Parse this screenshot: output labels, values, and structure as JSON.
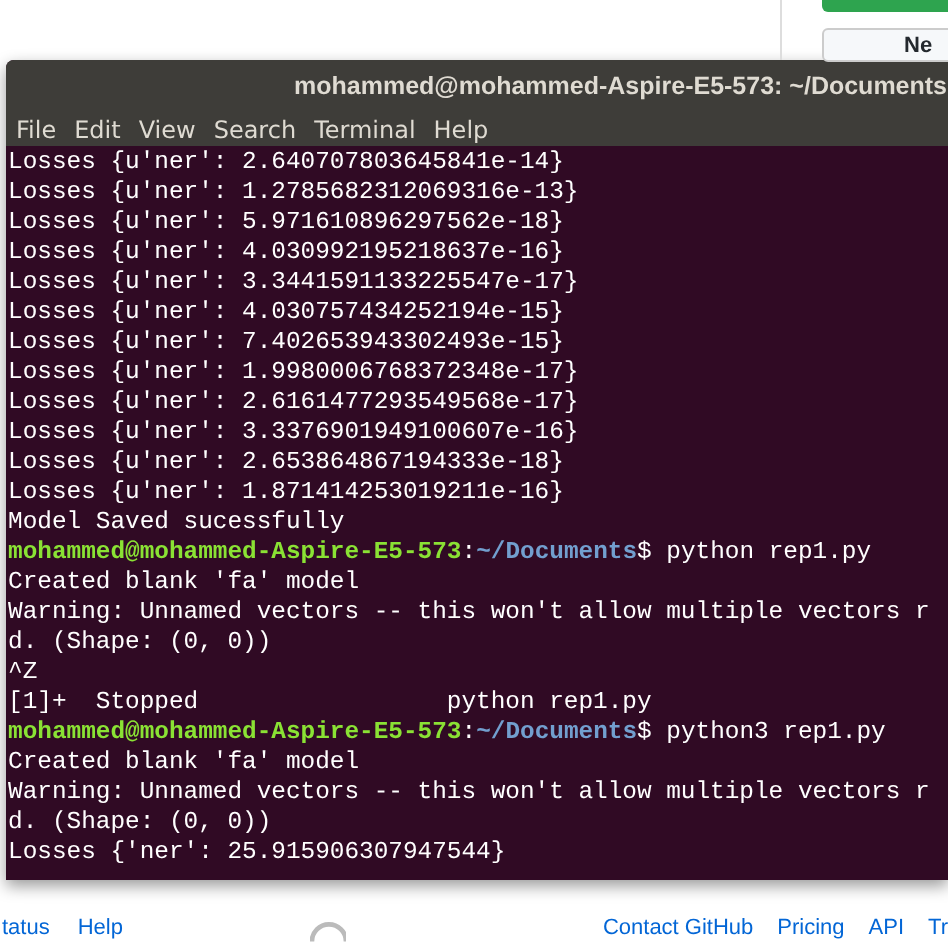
{
  "background_page": {
    "top_buttons": [
      {
        "kind": "primary"
      },
      {
        "kind": "secondary",
        "label": "Ne"
      }
    ],
    "footer_links_left": [
      "tatus",
      "Help"
    ],
    "footer_links_right": [
      "Contact GitHub",
      "Pricing",
      "API",
      "Tr"
    ]
  },
  "window": {
    "title": "mohammed@mohammed-Aspire-E5-573: ~/Documents"
  },
  "menu": [
    "File",
    "Edit",
    "View",
    "Search",
    "Terminal",
    "Help"
  ],
  "lines": [
    {
      "kind": "output",
      "text": "Losses {u'ner': 2.640707803645841e-14}"
    },
    {
      "kind": "output",
      "text": "Losses {u'ner': 1.2785682312069316e-13}"
    },
    {
      "kind": "output",
      "text": "Losses {u'ner': 5.971610896297562e-18}"
    },
    {
      "kind": "output",
      "text": "Losses {u'ner': 4.030992195218637e-16}"
    },
    {
      "kind": "output",
      "text": "Losses {u'ner': 3.3441591133225547e-17}"
    },
    {
      "kind": "output",
      "text": "Losses {u'ner': 4.030757434252194e-15}"
    },
    {
      "kind": "output",
      "text": "Losses {u'ner': 7.402653943302493e-15}"
    },
    {
      "kind": "output",
      "text": "Losses {u'ner': 1.9980006768372348e-17}"
    },
    {
      "kind": "output",
      "text": "Losses {u'ner': 2.6161477293549568e-17}"
    },
    {
      "kind": "output",
      "text": "Losses {u'ner': 3.3376901949100607e-16}"
    },
    {
      "kind": "output",
      "text": "Losses {u'ner': 2.653864867194333e-18}"
    },
    {
      "kind": "output",
      "text": "Losses {u'ner': 1.871414253019211e-16}"
    },
    {
      "kind": "output",
      "text": "Model Saved sucessfully"
    },
    {
      "kind": "prompt",
      "user": "mohammed@mohammed-Aspire-E5-573",
      "sep": ":",
      "path": "~/Documents",
      "command": "$ python rep1.py"
    },
    {
      "kind": "output",
      "text": "Created blank 'fa' model"
    },
    {
      "kind": "output",
      "text": "Warning: Unnamed vectors -- this won't allow multiple vectors r"
    },
    {
      "kind": "output",
      "text": "d. (Shape: (0, 0))"
    },
    {
      "kind": "output",
      "text": "^Z"
    },
    {
      "kind": "output",
      "text": "[1]+  Stopped                 python rep1.py"
    },
    {
      "kind": "prompt",
      "user": "mohammed@mohammed-Aspire-E5-573",
      "sep": ":",
      "path": "~/Documents",
      "command": "$ python3 rep1.py"
    },
    {
      "kind": "output",
      "text": "Created blank 'fa' model"
    },
    {
      "kind": "output",
      "text": "Warning: Unnamed vectors -- this won't allow multiple vectors r"
    },
    {
      "kind": "output",
      "text": "d. (Shape: (0, 0))"
    },
    {
      "kind": "output",
      "text": "Losses {'ner': 25.915906307947544}"
    }
  ]
}
